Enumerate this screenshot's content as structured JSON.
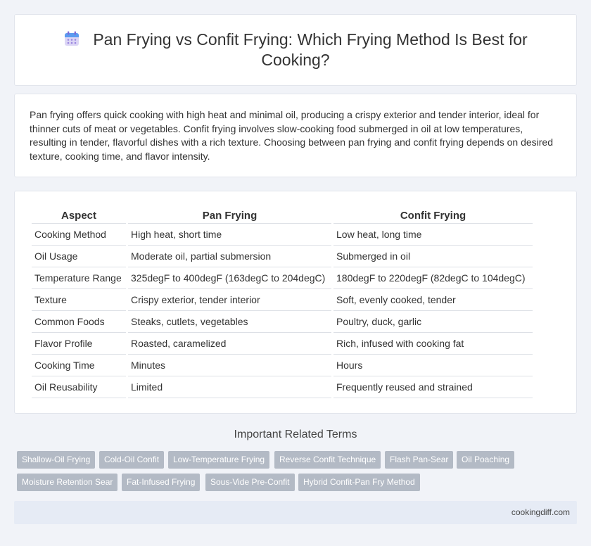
{
  "header": {
    "title": "Pan Frying vs Confit Frying: Which Frying Method Is Best for Cooking?",
    "icon": "calendar-icon"
  },
  "summary": "Pan frying offers quick cooking with high heat and minimal oil, producing a crispy exterior and tender interior, ideal for thinner cuts of meat or vegetables. Confit frying involves slow-cooking food submerged in oil at low temperatures, resulting in tender, flavorful dishes with a rich texture. Choosing between pan frying and confit frying depends on desired texture, cooking time, and flavor intensity.",
  "table": {
    "headers": [
      "Aspect",
      "Pan Frying",
      "Confit Frying"
    ],
    "rows": [
      [
        "Cooking Method",
        "High heat, short time",
        "Low heat, long time"
      ],
      [
        "Oil Usage",
        "Moderate oil, partial submersion",
        "Submerged in oil"
      ],
      [
        "Temperature Range",
        "325degF to 400degF (163degC to 204degC)",
        "180degF to 220degF (82degC to 104degC)"
      ],
      [
        "Texture",
        "Crispy exterior, tender interior",
        "Soft, evenly cooked, tender"
      ],
      [
        "Common Foods",
        "Steaks, cutlets, vegetables",
        "Poultry, duck, garlic"
      ],
      [
        "Flavor Profile",
        "Roasted, caramelized",
        "Rich, infused with cooking fat"
      ],
      [
        "Cooking Time",
        "Minutes",
        "Hours"
      ],
      [
        "Oil Reusability",
        "Limited",
        "Frequently reused and strained"
      ]
    ]
  },
  "related": {
    "title": "Important Related Terms",
    "tags": [
      "Shallow-Oil Frying",
      "Cold-Oil Confit",
      "Low-Temperature Frying",
      "Reverse Confit Technique",
      "Flash Pan-Sear",
      "Oil Poaching",
      "Moisture Retention Sear",
      "Fat-Infused Frying",
      "Sous-Vide Pre-Confit",
      "Hybrid Confit-Pan Fry Method"
    ]
  },
  "footer": {
    "site": "cookingdiff.com"
  },
  "colors": {
    "background": "#f1f3f8",
    "tag": "#b3bac5",
    "footer": "#e6ebf5"
  }
}
